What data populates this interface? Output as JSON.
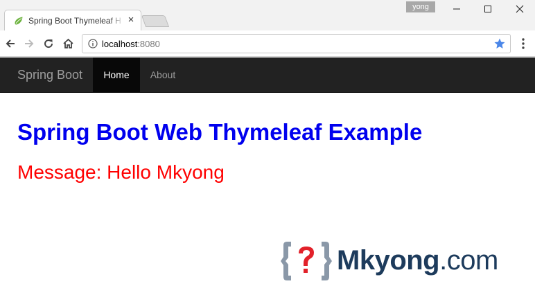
{
  "browser": {
    "tab_title": "Spring Boot Thymeleaf H",
    "profile_name": "yong",
    "url_host": "localhost",
    "url_port": ":8080"
  },
  "navbar": {
    "brand": "Spring Boot",
    "items": [
      {
        "label": "Home",
        "active": true
      },
      {
        "label": "About",
        "active": false
      }
    ]
  },
  "content": {
    "heading": "Spring Boot Web Thymeleaf Example",
    "message_prefix": "Message: ",
    "message_value": "Hello Mkyong"
  },
  "watermark": {
    "brand": "Mkyong",
    "suffix": ".com"
  },
  "colors": {
    "heading": "#0000ee",
    "message": "#ff0000",
    "navbar_bg": "#222222",
    "logo": "#1d3b5c",
    "favicon": "#6db33f"
  },
  "icons": [
    "spring-leaf-icon",
    "close-icon",
    "minimize-icon",
    "maximize-icon",
    "back-arrow-icon",
    "forward-arrow-icon",
    "reload-icon",
    "home-icon",
    "info-icon",
    "star-icon",
    "menu-dots-icon",
    "mkyong-logo-icon"
  ]
}
